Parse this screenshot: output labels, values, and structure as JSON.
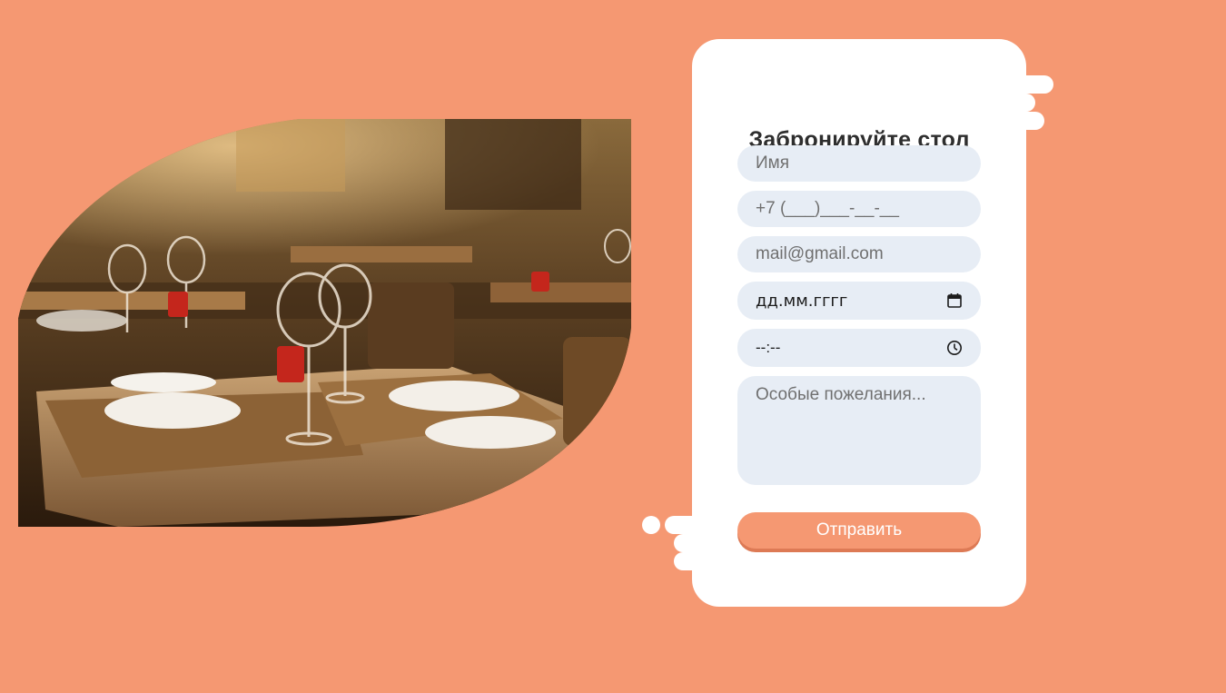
{
  "form": {
    "title": "Забронируйте стол",
    "name_placeholder": "Имя",
    "phone_placeholder": "+7 (___)___-__-__",
    "email_placeholder": "mail@gmail.com",
    "date_placeholder": "дд.мм.гггг",
    "time_placeholder": "--:--",
    "wishes_placeholder": "Особые пожелания...",
    "submit_label": "Отправить"
  },
  "icons": {
    "date": "calendar-icon",
    "time": "clock-icon"
  },
  "colors": {
    "background": "#f59872",
    "card": "#ffffff",
    "field": "#e7edf5",
    "button": "#f59872"
  }
}
